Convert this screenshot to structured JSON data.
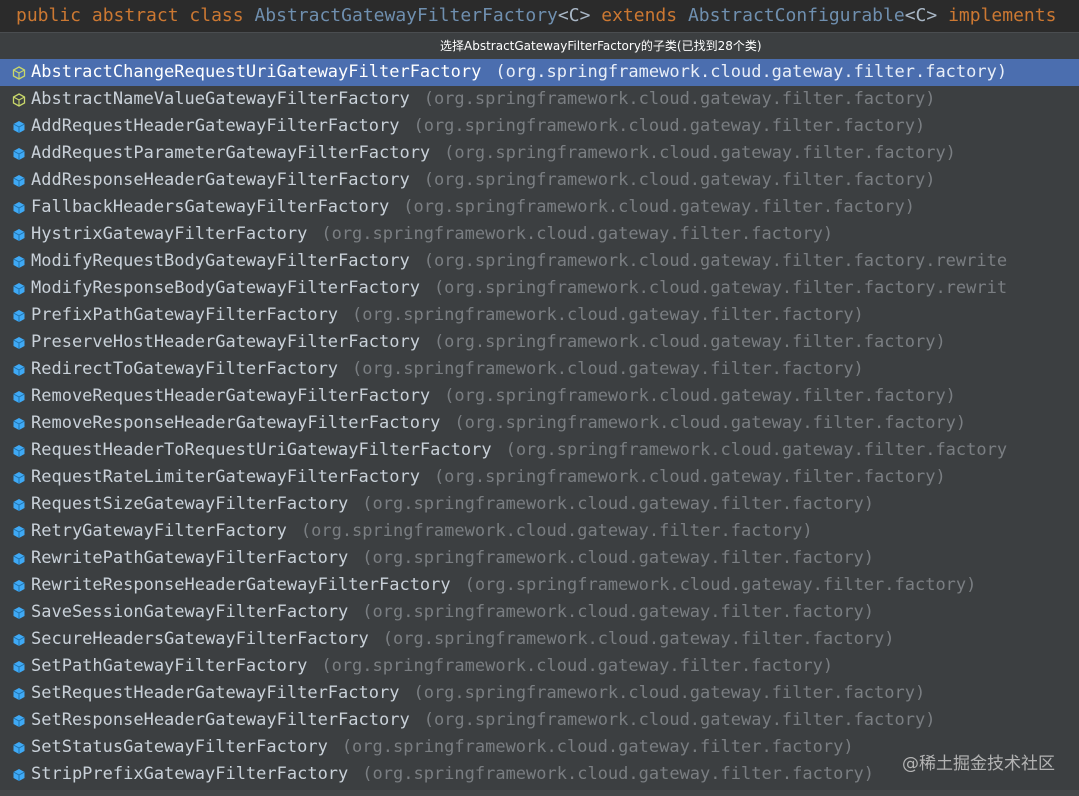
{
  "editor": {
    "kw_public": "public",
    "kw_abstract": "abstract",
    "kw_class": "class",
    "class_name": "AbstractGatewayFilterFactory",
    "generic_c": "<C>",
    "kw_extends": "extends",
    "super_name": "AbstractConfigurable",
    "generic_c2": "<C>",
    "kw_implements": "implements"
  },
  "popup": {
    "title": "选择AbstractGatewayFilterFactory的子类(已找到28个类)",
    "items": [
      {
        "name": "AbstractChangeRequestUriGatewayFilterFactory",
        "pkg": "(org.springframework.cloud.gateway.filter.factory)",
        "icon": "abstract-class-icon",
        "selected": true
      },
      {
        "name": "AbstractNameValueGatewayFilterFactory",
        "pkg": "(org.springframework.cloud.gateway.filter.factory)",
        "icon": "abstract-class-icon"
      },
      {
        "name": "AddRequestHeaderGatewayFilterFactory",
        "pkg": "(org.springframework.cloud.gateway.filter.factory)",
        "icon": "class-icon"
      },
      {
        "name": "AddRequestParameterGatewayFilterFactory",
        "pkg": "(org.springframework.cloud.gateway.filter.factory)",
        "icon": "class-icon"
      },
      {
        "name": "AddResponseHeaderGatewayFilterFactory",
        "pkg": "(org.springframework.cloud.gateway.filter.factory)",
        "icon": "class-icon"
      },
      {
        "name": "FallbackHeadersGatewayFilterFactory",
        "pkg": "(org.springframework.cloud.gateway.filter.factory)",
        "icon": "class-icon"
      },
      {
        "name": "HystrixGatewayFilterFactory",
        "pkg": "(org.springframework.cloud.gateway.filter.factory)",
        "icon": "class-icon"
      },
      {
        "name": "ModifyRequestBodyGatewayFilterFactory",
        "pkg": "(org.springframework.cloud.gateway.filter.factory.rewrite",
        "icon": "class-icon"
      },
      {
        "name": "ModifyResponseBodyGatewayFilterFactory",
        "pkg": "(org.springframework.cloud.gateway.filter.factory.rewrit",
        "icon": "class-icon"
      },
      {
        "name": "PrefixPathGatewayFilterFactory",
        "pkg": "(org.springframework.cloud.gateway.filter.factory)",
        "icon": "class-icon"
      },
      {
        "name": "PreserveHostHeaderGatewayFilterFactory",
        "pkg": "(org.springframework.cloud.gateway.filter.factory)",
        "icon": "class-icon"
      },
      {
        "name": "RedirectToGatewayFilterFactory",
        "pkg": "(org.springframework.cloud.gateway.filter.factory)",
        "icon": "class-icon"
      },
      {
        "name": "RemoveRequestHeaderGatewayFilterFactory",
        "pkg": "(org.springframework.cloud.gateway.filter.factory)",
        "icon": "class-icon"
      },
      {
        "name": "RemoveResponseHeaderGatewayFilterFactory",
        "pkg": "(org.springframework.cloud.gateway.filter.factory)",
        "icon": "class-icon"
      },
      {
        "name": "RequestHeaderToRequestUriGatewayFilterFactory",
        "pkg": "(org.springframework.cloud.gateway.filter.factory",
        "icon": "class-icon"
      },
      {
        "name": "RequestRateLimiterGatewayFilterFactory",
        "pkg": "(org.springframework.cloud.gateway.filter.factory)",
        "icon": "class-icon"
      },
      {
        "name": "RequestSizeGatewayFilterFactory",
        "pkg": "(org.springframework.cloud.gateway.filter.factory)",
        "icon": "class-icon"
      },
      {
        "name": "RetryGatewayFilterFactory",
        "pkg": "(org.springframework.cloud.gateway.filter.factory)",
        "icon": "class-icon"
      },
      {
        "name": "RewritePathGatewayFilterFactory",
        "pkg": "(org.springframework.cloud.gateway.filter.factory)",
        "icon": "class-icon"
      },
      {
        "name": "RewriteResponseHeaderGatewayFilterFactory",
        "pkg": "(org.springframework.cloud.gateway.filter.factory)",
        "icon": "class-icon"
      },
      {
        "name": "SaveSessionGatewayFilterFactory",
        "pkg": "(org.springframework.cloud.gateway.filter.factory)",
        "icon": "class-icon"
      },
      {
        "name": "SecureHeadersGatewayFilterFactory",
        "pkg": "(org.springframework.cloud.gateway.filter.factory)",
        "icon": "class-icon"
      },
      {
        "name": "SetPathGatewayFilterFactory",
        "pkg": "(org.springframework.cloud.gateway.filter.factory)",
        "icon": "class-icon"
      },
      {
        "name": "SetRequestHeaderGatewayFilterFactory",
        "pkg": "(org.springframework.cloud.gateway.filter.factory)",
        "icon": "class-icon"
      },
      {
        "name": "SetResponseHeaderGatewayFilterFactory",
        "pkg": "(org.springframework.cloud.gateway.filter.factory)",
        "icon": "class-icon"
      },
      {
        "name": "SetStatusGatewayFilterFactory",
        "pkg": "(org.springframework.cloud.gateway.filter.factory)",
        "icon": "class-icon"
      },
      {
        "name": "StripPrefixGatewayFilterFactory",
        "pkg": "(org.springframework.cloud.gateway.filter.factory)",
        "icon": "class-icon"
      }
    ]
  },
  "watermark": "@稀土掘金技术社区",
  "colors": {
    "selected_bg": "#4b6eaf",
    "popup_bg": "#3c3f41",
    "class_icon": "#3fa9f5",
    "abstract_icon": "#c9d86a"
  }
}
